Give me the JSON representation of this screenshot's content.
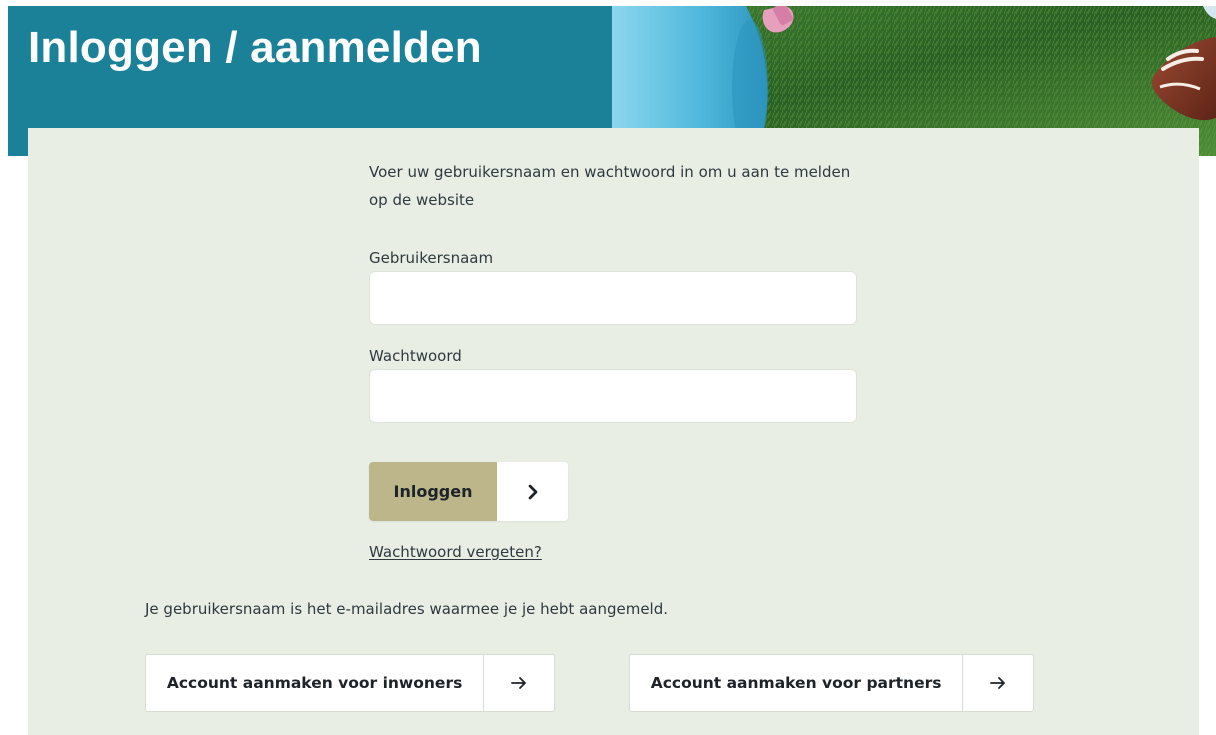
{
  "header": {
    "title": "Inloggen / aanmelden",
    "background_color": "#1b8198"
  },
  "form": {
    "intro_text": "Voer uw gebruikersnaam en wachtwoord in om u aan te melden op de website",
    "username_label": "Gebruikersnaam",
    "username_value": "",
    "password_label": "Wachtwoord",
    "password_value": "",
    "login_label": "Inloggen",
    "login_icon": "chevron-right-icon",
    "login_color": "#bdb68b",
    "forgot_link": "Wachtwoord vergeten?"
  },
  "username_note": "Je gebruikersnaam is het e-mailadres waarmee je je hebt aangemeld.",
  "account_buttons": [
    {
      "label": "Account aanmaken voor inwoners",
      "icon": "arrow-right-icon"
    },
    {
      "label": "Account aanmaken voor partners",
      "icon": "arrow-right-icon"
    }
  ]
}
